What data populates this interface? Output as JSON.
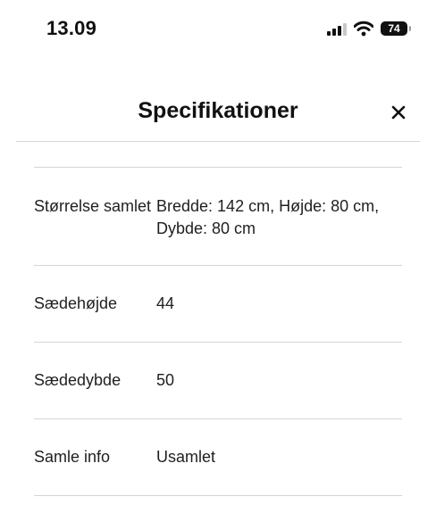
{
  "status_bar": {
    "time": "13.09",
    "battery_level": "74",
    "icons": [
      "cellular-signal-icon",
      "wifi-icon",
      "battery-icon"
    ]
  },
  "header": {
    "title": "Specifikationer",
    "close_icon": "close-icon",
    "close_label": "×"
  },
  "specs": [
    {
      "label": "Størrelse samlet",
      "value": "Bredde: 142 cm, Højde: 80 cm, Dybde: 80 cm"
    },
    {
      "label": "Sædehøjde",
      "value": "44"
    },
    {
      "label": "Sædedybde",
      "value": "50"
    },
    {
      "label": "Samle info",
      "value": "Usamlet"
    }
  ]
}
